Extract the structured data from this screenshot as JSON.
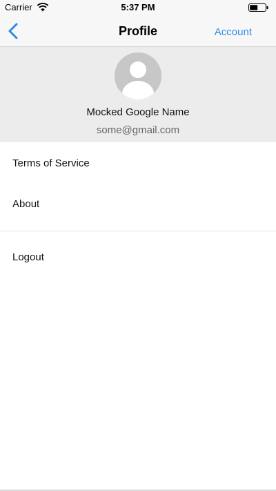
{
  "status_bar": {
    "carrier": "Carrier",
    "time": "5:37 PM",
    "icons": [
      "wifi-icon",
      "battery-icon"
    ]
  },
  "nav_bar": {
    "back_icon": "chevron-left-icon",
    "title": "Profile",
    "account_label": "Account",
    "accent_color": "#2f8ae5"
  },
  "profile": {
    "avatar_icon": "user-silhouette-icon",
    "name": "Mocked Google Name",
    "email": "some@gmail.com"
  },
  "menu": {
    "items": [
      {
        "label": "Terms of Service"
      },
      {
        "label": "About"
      },
      {
        "label": "Logout"
      }
    ]
  }
}
